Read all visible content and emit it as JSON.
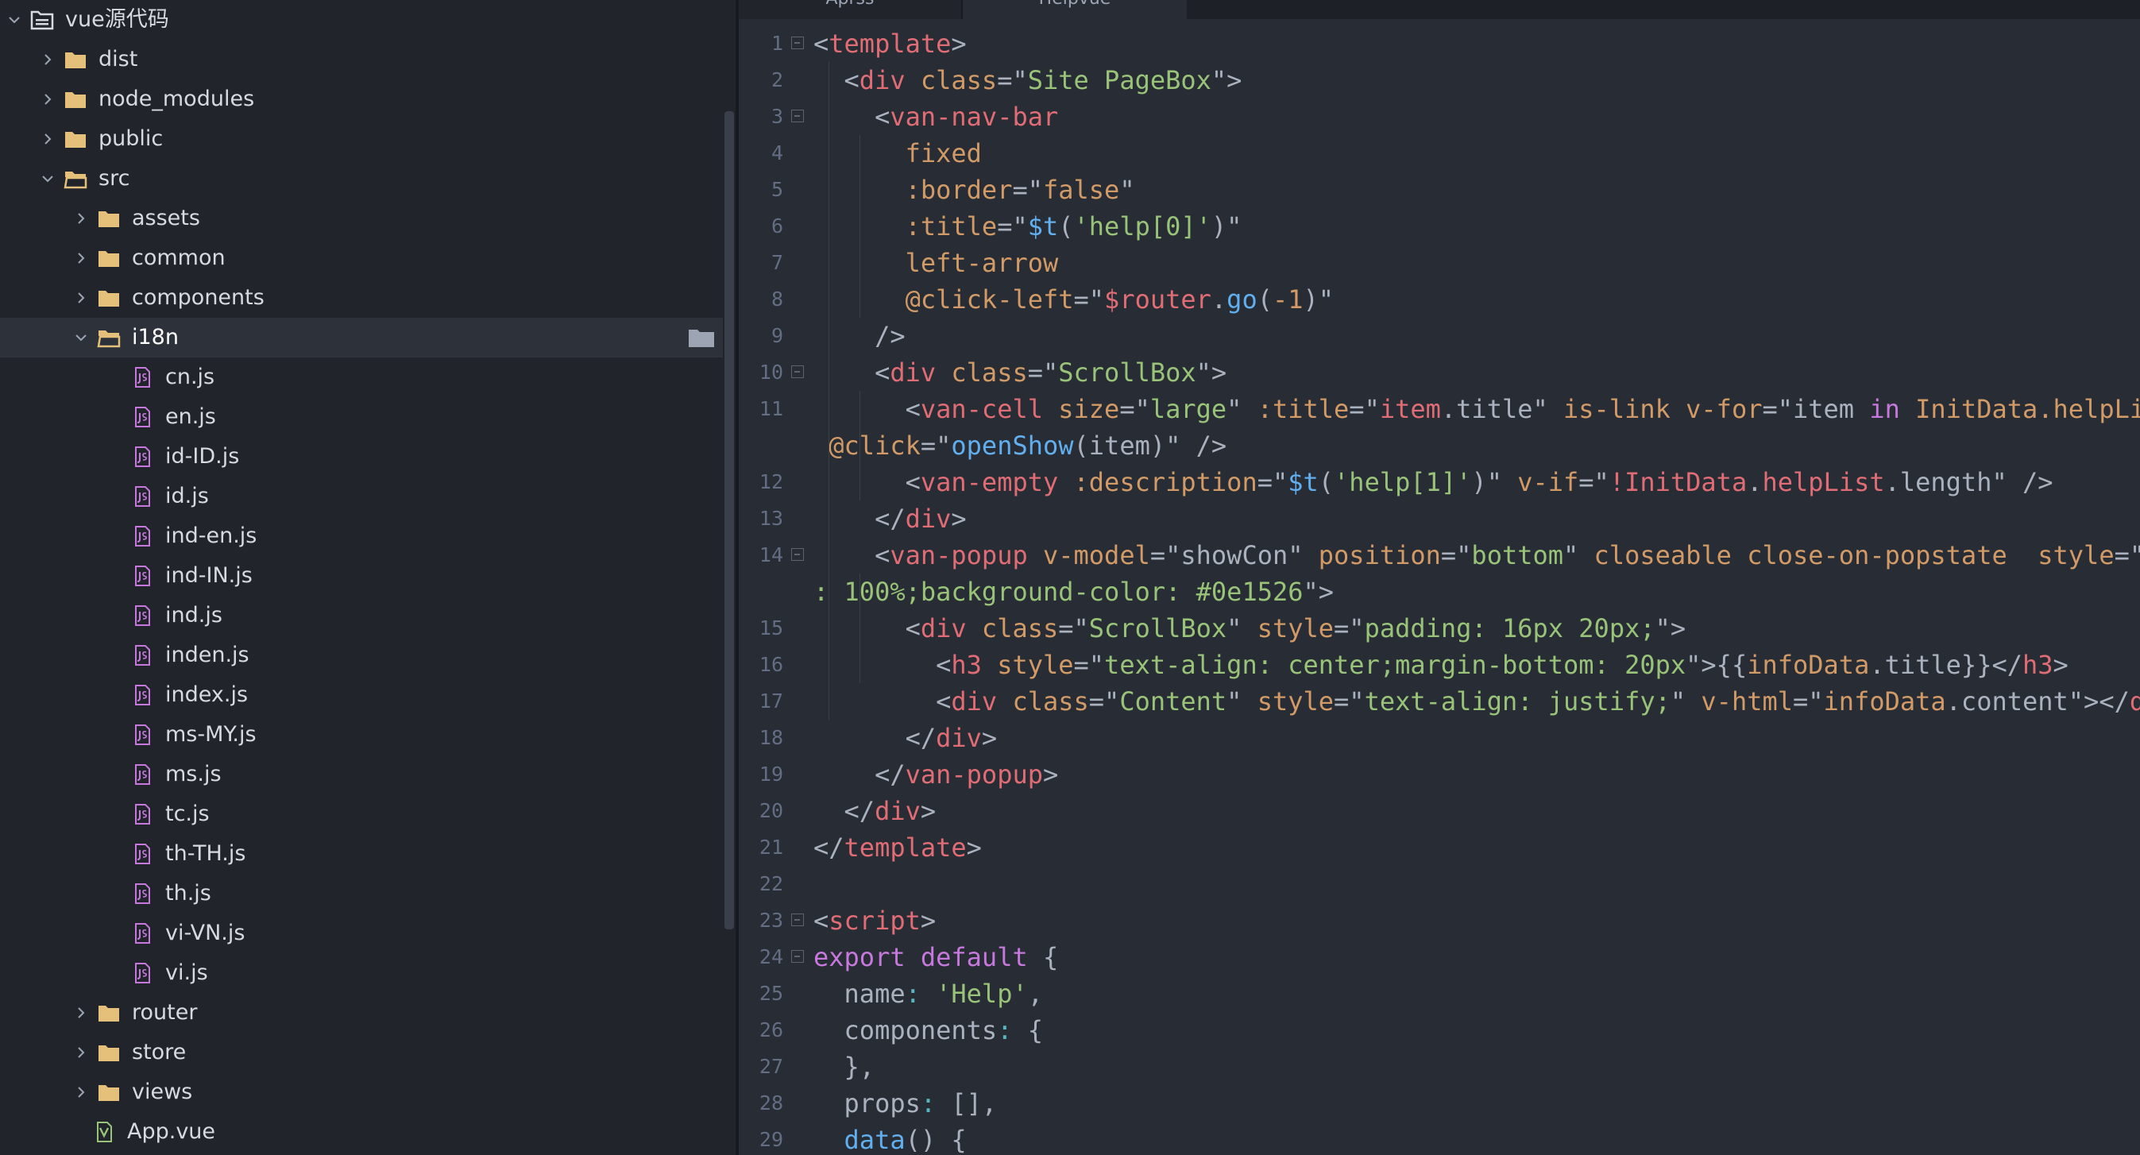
{
  "colors": {
    "sidebar_bg": "#21252b",
    "editor_bg": "#282c34",
    "selection_bg": "#2c313a",
    "folder_icon": "#e5c07b",
    "file_icon": "#c678dd",
    "vue_icon": "#98c379",
    "tag": "#e06c75",
    "attr": "#d19a66",
    "string": "#98c379",
    "function": "#61afef",
    "keyword": "#c678dd"
  },
  "sidebar": {
    "items": [
      {
        "label": "vue源代码",
        "kind": "root",
        "state": "expanded",
        "depth": 0
      },
      {
        "label": "dist",
        "kind": "folder",
        "state": "collapsed",
        "depth": 1
      },
      {
        "label": "node_modules",
        "kind": "folder",
        "state": "collapsed",
        "depth": 1
      },
      {
        "label": "public",
        "kind": "folder",
        "state": "collapsed",
        "depth": 1
      },
      {
        "label": "src",
        "kind": "folder",
        "state": "expanded",
        "depth": 1
      },
      {
        "label": "assets",
        "kind": "folder",
        "state": "collapsed",
        "depth": 2
      },
      {
        "label": "common",
        "kind": "folder",
        "state": "collapsed",
        "depth": 2
      },
      {
        "label": "components",
        "kind": "folder",
        "state": "collapsed",
        "depth": 2
      },
      {
        "label": "i18n",
        "kind": "folder",
        "state": "expanded",
        "depth": 2,
        "selected": true
      },
      {
        "label": "cn.js",
        "kind": "file",
        "depth": 3
      },
      {
        "label": "en.js",
        "kind": "file",
        "depth": 3
      },
      {
        "label": "id-ID.js",
        "kind": "file",
        "depth": 3
      },
      {
        "label": "id.js",
        "kind": "file",
        "depth": 3
      },
      {
        "label": "ind-en.js",
        "kind": "file",
        "depth": 3
      },
      {
        "label": "ind-IN.js",
        "kind": "file",
        "depth": 3
      },
      {
        "label": "ind.js",
        "kind": "file",
        "depth": 3
      },
      {
        "label": "inden.js",
        "kind": "file",
        "depth": 3
      },
      {
        "label": "index.js",
        "kind": "file",
        "depth": 3
      },
      {
        "label": "ms-MY.js",
        "kind": "file",
        "depth": 3
      },
      {
        "label": "ms.js",
        "kind": "file",
        "depth": 3
      },
      {
        "label": "tc.js",
        "kind": "file",
        "depth": 3
      },
      {
        "label": "th-TH.js",
        "kind": "file",
        "depth": 3
      },
      {
        "label": "th.js",
        "kind": "file",
        "depth": 3
      },
      {
        "label": "vi-VN.js",
        "kind": "file",
        "depth": 3
      },
      {
        "label": "vi.js",
        "kind": "file",
        "depth": 3
      },
      {
        "label": "router",
        "kind": "folder",
        "state": "collapsed",
        "depth": 2
      },
      {
        "label": "store",
        "kind": "folder",
        "state": "collapsed",
        "depth": 2
      },
      {
        "label": "views",
        "kind": "folder",
        "state": "collapsed",
        "depth": 2
      },
      {
        "label": "App.vue",
        "kind": "vue",
        "depth": 2
      }
    ]
  },
  "tabs": [
    {
      "label": "Aprss",
      "active": false
    },
    {
      "label": "Helpvue",
      "active": true
    }
  ],
  "editor": {
    "lines": [
      {
        "n": "1",
        "fold": true,
        "tokens": [
          [
            "pu",
            "<"
          ],
          [
            "tg",
            "template"
          ],
          [
            "pu",
            ">"
          ]
        ]
      },
      {
        "n": "2",
        "fold": false,
        "tokens": [
          [
            "pu",
            "  <"
          ],
          [
            "tg",
            "div"
          ],
          [
            "pu",
            " "
          ],
          [
            "at",
            "class"
          ],
          [
            "pu",
            "=\""
          ],
          [
            "st",
            "Site PageBox"
          ],
          [
            "pu",
            "\">"
          ]
        ]
      },
      {
        "n": "3",
        "fold": true,
        "tokens": [
          [
            "pu",
            "    <"
          ],
          [
            "tg",
            "van-nav-bar"
          ]
        ]
      },
      {
        "n": "4",
        "fold": false,
        "tokens": [
          [
            "pu",
            "      "
          ],
          [
            "at",
            "fixed"
          ]
        ]
      },
      {
        "n": "5",
        "fold": false,
        "tokens": [
          [
            "pu",
            "      "
          ],
          [
            "at",
            ":border"
          ],
          [
            "pu",
            "=\""
          ],
          [
            "at",
            "false"
          ],
          [
            "pu",
            "\""
          ]
        ]
      },
      {
        "n": "6",
        "fold": false,
        "tokens": [
          [
            "pu",
            "      "
          ],
          [
            "at",
            ":title"
          ],
          [
            "pu",
            "=\""
          ],
          [
            "fn",
            "$t"
          ],
          [
            "pu",
            "("
          ],
          [
            "st",
            "'help[0]'"
          ],
          [
            "pu",
            ")\""
          ]
        ]
      },
      {
        "n": "7",
        "fold": false,
        "tokens": [
          [
            "pu",
            "      "
          ],
          [
            "at",
            "left-arrow"
          ]
        ]
      },
      {
        "n": "8",
        "fold": false,
        "tokens": [
          [
            "pu",
            "      "
          ],
          [
            "at",
            "@click-left"
          ],
          [
            "pu",
            "=\""
          ],
          [
            "tg",
            "$router"
          ],
          [
            "pu",
            "."
          ],
          [
            "fn",
            "go"
          ],
          [
            "pu",
            "("
          ],
          [
            "at",
            "-1"
          ],
          [
            "pu",
            ")\""
          ]
        ]
      },
      {
        "n": "9",
        "fold": false,
        "tokens": [
          [
            "pu",
            "    />"
          ]
        ]
      },
      {
        "n": "10",
        "fold": true,
        "tokens": [
          [
            "pu",
            "    <"
          ],
          [
            "tg",
            "div"
          ],
          [
            "pu",
            " "
          ],
          [
            "at",
            "class"
          ],
          [
            "pu",
            "=\""
          ],
          [
            "st",
            "ScrollBox"
          ],
          [
            "pu",
            "\">"
          ]
        ]
      },
      {
        "n": "11",
        "fold": false,
        "tokens": [
          [
            "pu",
            "      <"
          ],
          [
            "tg",
            "van-cell"
          ],
          [
            "pu",
            " "
          ],
          [
            "at",
            "size"
          ],
          [
            "pu",
            "=\""
          ],
          [
            "st",
            "large"
          ],
          [
            "pu",
            "\" "
          ],
          [
            "at",
            ":title"
          ],
          [
            "pu",
            "=\""
          ],
          [
            "tg",
            "item"
          ],
          [
            "pu",
            ".title\" "
          ],
          [
            "at",
            "is-link"
          ],
          [
            "pu",
            " "
          ],
          [
            "at",
            "v-for"
          ],
          [
            "pu",
            "=\"item "
          ],
          [
            "kw",
            "in"
          ],
          [
            "pu",
            " "
          ],
          [
            "at",
            "InitData.helpList"
          ]
        ]
      },
      {
        "n": "",
        "fold": false,
        "tokens": [
          [
            "pu",
            " "
          ],
          [
            "at",
            "@click"
          ],
          [
            "pu",
            "=\""
          ],
          [
            "fn",
            "openShow"
          ],
          [
            "pu",
            "(item)\" />"
          ]
        ]
      },
      {
        "n": "12",
        "fold": false,
        "tokens": [
          [
            "pu",
            "      <"
          ],
          [
            "tg",
            "van-empty"
          ],
          [
            "pu",
            " "
          ],
          [
            "at",
            ":description"
          ],
          [
            "pu",
            "=\""
          ],
          [
            "fn",
            "$t"
          ],
          [
            "pu",
            "("
          ],
          [
            "st",
            "'help[1]'"
          ],
          [
            "pu",
            ")\" "
          ],
          [
            "at",
            "v-if"
          ],
          [
            "pu",
            "=\""
          ],
          [
            "tg",
            "!InitData"
          ],
          [
            "pu",
            "."
          ],
          [
            "tg",
            "helpList"
          ],
          [
            "pu",
            ".length\" />"
          ]
        ]
      },
      {
        "n": "13",
        "fold": false,
        "tokens": [
          [
            "pu",
            "    </"
          ],
          [
            "tg",
            "div"
          ],
          [
            "pu",
            ">"
          ]
        ]
      },
      {
        "n": "14",
        "fold": true,
        "tokens": [
          [
            "pu",
            "    <"
          ],
          [
            "tg",
            "van-popup"
          ],
          [
            "pu",
            " "
          ],
          [
            "at",
            "v-model"
          ],
          [
            "pu",
            "=\"showCon\" "
          ],
          [
            "at",
            "position"
          ],
          [
            "pu",
            "=\""
          ],
          [
            "st",
            "bottom"
          ],
          [
            "pu",
            "\" "
          ],
          [
            "at",
            "closeable"
          ],
          [
            "pu",
            " "
          ],
          [
            "at",
            "close-on-popstate"
          ],
          [
            "pu",
            "  "
          ],
          [
            "at",
            "style"
          ],
          [
            "pu",
            "=\""
          ]
        ]
      },
      {
        "n": "",
        "fold": false,
        "tokens": [
          [
            "st",
            ": 100%;background-color: "
          ],
          [
            "st",
            "#0e1526"
          ],
          [
            "pu",
            "\">"
          ]
        ]
      },
      {
        "n": "15",
        "fold": false,
        "tokens": [
          [
            "pu",
            "      <"
          ],
          [
            "tg",
            "div"
          ],
          [
            "pu",
            " "
          ],
          [
            "at",
            "class"
          ],
          [
            "pu",
            "=\""
          ],
          [
            "st",
            "ScrollBox"
          ],
          [
            "pu",
            "\" "
          ],
          [
            "at",
            "style"
          ],
          [
            "pu",
            "=\""
          ],
          [
            "st",
            "padding: 16px 20px;"
          ],
          [
            "pu",
            "\">"
          ]
        ]
      },
      {
        "n": "16",
        "fold": false,
        "tokens": [
          [
            "pu",
            "        <"
          ],
          [
            "tg",
            "h3"
          ],
          [
            "pu",
            " "
          ],
          [
            "at",
            "style"
          ],
          [
            "pu",
            "=\""
          ],
          [
            "st",
            "text-align: center;margin-bottom: 20px"
          ],
          [
            "pu",
            "\">{{"
          ],
          [
            "at",
            "infoData"
          ],
          [
            "pu",
            ".title}}</"
          ],
          [
            "tg",
            "h3"
          ],
          [
            "pu",
            ">"
          ]
        ]
      },
      {
        "n": "17",
        "fold": false,
        "tokens": [
          [
            "pu",
            "        <"
          ],
          [
            "tg",
            "div"
          ],
          [
            "pu",
            " "
          ],
          [
            "at",
            "class"
          ],
          [
            "pu",
            "=\""
          ],
          [
            "st",
            "Content"
          ],
          [
            "pu",
            "\" "
          ],
          [
            "at",
            "style"
          ],
          [
            "pu",
            "=\""
          ],
          [
            "st",
            "text-align: justify;"
          ],
          [
            "pu",
            "\" "
          ],
          [
            "at",
            "v-html"
          ],
          [
            "pu",
            "=\""
          ],
          [
            "at",
            "infoData"
          ],
          [
            "pu",
            ".content\"></"
          ],
          [
            "tg",
            "div"
          ],
          [
            "pu",
            ">"
          ]
        ]
      },
      {
        "n": "18",
        "fold": false,
        "tokens": [
          [
            "pu",
            "      </"
          ],
          [
            "tg",
            "div"
          ],
          [
            "pu",
            ">"
          ]
        ]
      },
      {
        "n": "19",
        "fold": false,
        "tokens": [
          [
            "pu",
            "    </"
          ],
          [
            "tg",
            "van-popup"
          ],
          [
            "pu",
            ">"
          ]
        ]
      },
      {
        "n": "20",
        "fold": false,
        "tokens": [
          [
            "pu",
            "  </"
          ],
          [
            "tg",
            "div"
          ],
          [
            "pu",
            ">"
          ]
        ]
      },
      {
        "n": "21",
        "fold": false,
        "tokens": [
          [
            "pu",
            "</"
          ],
          [
            "tg",
            "template"
          ],
          [
            "pu",
            ">"
          ]
        ]
      },
      {
        "n": "22",
        "fold": false,
        "tokens": []
      },
      {
        "n": "23",
        "fold": true,
        "tokens": [
          [
            "pu",
            "<"
          ],
          [
            "tg",
            "script"
          ],
          [
            "pu",
            ">"
          ]
        ]
      },
      {
        "n": "24",
        "fold": true,
        "tokens": [
          [
            "kw",
            "export"
          ],
          [
            "pu",
            " "
          ],
          [
            "kw",
            "default"
          ],
          [
            "pu",
            " {"
          ]
        ]
      },
      {
        "n": "25",
        "fold": false,
        "tokens": [
          [
            "pu",
            "  name"
          ],
          [
            "cy",
            ":"
          ],
          [
            "pu",
            " "
          ],
          [
            "st",
            "'Help'"
          ],
          [
            "pu",
            ","
          ]
        ]
      },
      {
        "n": "26",
        "fold": false,
        "tokens": [
          [
            "pu",
            "  components"
          ],
          [
            "cy",
            ":"
          ],
          [
            "pu",
            " {"
          ]
        ]
      },
      {
        "n": "27",
        "fold": false,
        "tokens": [
          [
            "pu",
            "  },"
          ]
        ]
      },
      {
        "n": "28",
        "fold": false,
        "tokens": [
          [
            "pu",
            "  props"
          ],
          [
            "cy",
            ":"
          ],
          [
            "pu",
            " [],"
          ]
        ]
      },
      {
        "n": "29",
        "fold": false,
        "tokens": [
          [
            "pu",
            "  "
          ],
          [
            "fn",
            "data"
          ],
          [
            "pu",
            "() {"
          ]
        ]
      }
    ]
  }
}
